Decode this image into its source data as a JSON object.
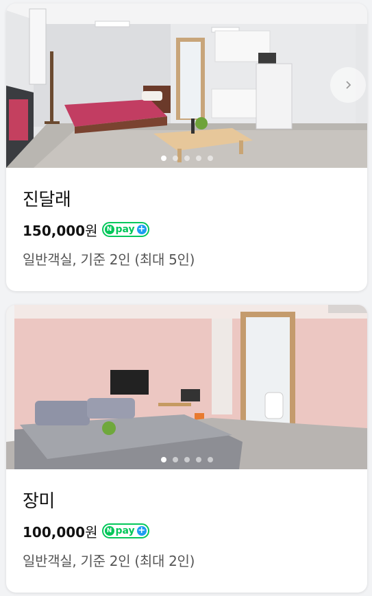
{
  "colors": {
    "npay_green": "#03c75a",
    "npay_blue": "#1e9df1"
  },
  "rooms": [
    {
      "name": "진달래",
      "price": "150,000",
      "currency": "원",
      "badge": {
        "n": "N",
        "text": "pay",
        "plus": "+"
      },
      "description": "일반객실, 기준 2인 (최대 5인)",
      "photo_count": 5,
      "active_photo": 1,
      "next_icon": "chevron-right-icon"
    },
    {
      "name": "장미",
      "price": "100,000",
      "currency": "원",
      "badge": {
        "n": "N",
        "text": "pay",
        "plus": "+"
      },
      "description": "일반객실, 기준 2인 (최대 2인)",
      "photo_count": 5,
      "active_photo": 1
    }
  ]
}
